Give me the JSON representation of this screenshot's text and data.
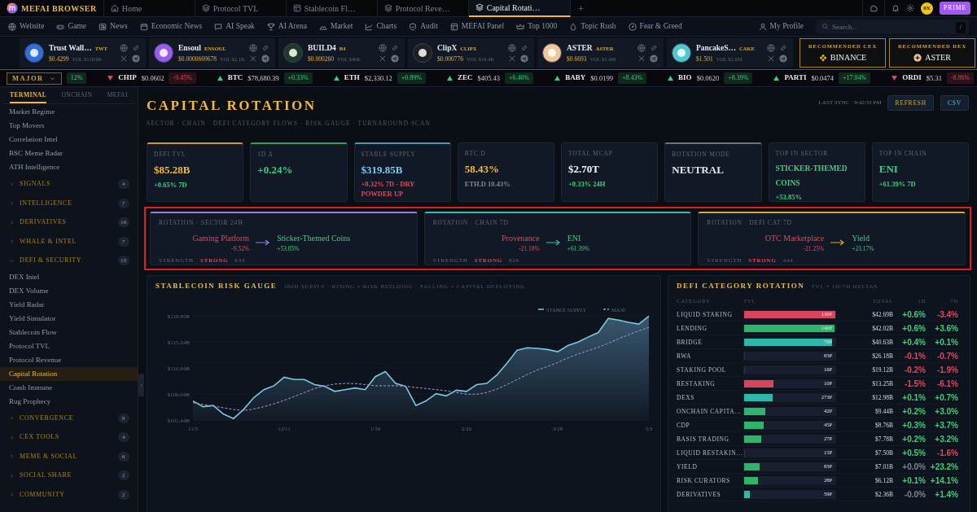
{
  "browser": {
    "brand": "MEFAI BROWSER",
    "tabs": [
      {
        "label": "Home",
        "selected": false
      },
      {
        "label": "Protocol TVL",
        "selected": false
      },
      {
        "label": "Stablecoin Fl…",
        "selected": false
      },
      {
        "label": "Protocol Reve…",
        "selected": false
      },
      {
        "label": "Capital Rotati…",
        "selected": true
      }
    ],
    "new_tab": "+",
    "avatar": "0X",
    "badge": "PRIME"
  },
  "nav": {
    "items": [
      "Website",
      "Game",
      "News",
      "Economic News",
      "AI Speak",
      "AI Arena",
      "Market",
      "Charts",
      "Audit",
      "MEFAI Panel",
      "Top 1000",
      "Topic Rush",
      "Fear & Greed"
    ],
    "profile": "My Profile",
    "search": {
      "placeholder": "Search...",
      "shortcut": "/"
    }
  },
  "tokens": [
    {
      "name": "Trust Wall…",
      "ticker": "TWT",
      "price": "$0.4299",
      "volume": "VOL $119.6K",
      "color": "#2f6fe0"
    },
    {
      "name": "Ensoul",
      "ticker": "ENSOUL",
      "price": "$0.0000669678",
      "volume": "VOL $2.1K",
      "color": "#9a5cf0"
    },
    {
      "name": "BUILD4",
      "ticker": "B4",
      "price": "$0.000260",
      "volume": "VOL $40K",
      "color": "#1f3a28"
    },
    {
      "name": "ClipX",
      "ticker": "CLIPX",
      "price": "$0.000776",
      "volume": "VOL $19.4K",
      "color": "#202020"
    },
    {
      "name": "ASTER",
      "ticker": "ASTER",
      "price": "$0.6693",
      "volume": "VOL $1.4M",
      "color": "#f2c79a"
    },
    {
      "name": "PancakeS…",
      "ticker": "CAKE",
      "price": "$1.501",
      "volume": "VOL $2.6M",
      "color": "#4fc8d0"
    }
  ],
  "recommended": [
    {
      "label": "RECOMMENDED CEX",
      "name": "BINANCE"
    },
    {
      "label": "RECOMMENDED DEX",
      "name": "ASTER"
    }
  ],
  "ticker": {
    "filter": "MAJOR",
    "items": [
      {
        "change": "12%",
        "rising": true
      },
      {
        "symbol": "CHIP",
        "price": "$0.0602",
        "change": "-9.45%",
        "rising": false
      },
      {
        "symbol": "BTC",
        "price": "$78,680.39",
        "change": "+0.33%",
        "rising": true
      },
      {
        "symbol": "ETH",
        "price": "$2,330.12",
        "change": "+0.89%",
        "rising": true
      },
      {
        "symbol": "ZEC",
        "price": "$405.43",
        "change": "+6.40%",
        "rising": true
      },
      {
        "symbol": "BABY",
        "price": "$0.0199",
        "change": "+8.43%",
        "rising": true
      },
      {
        "symbol": "BIO",
        "price": "$0.0620",
        "change": "+8.39%",
        "rising": true
      },
      {
        "symbol": "PARTI",
        "price": "$0.0474",
        "change": "+17.04%",
        "rising": true
      },
      {
        "symbol": "ORDI",
        "price": "$5.31",
        "change": "-8.86%",
        "rising": false
      }
    ]
  },
  "sidebar": {
    "tabs": [
      {
        "label": "TERMINAL",
        "selected": true
      },
      {
        "label": "ONCHAIN",
        "selected": false
      },
      {
        "label": "MEFAI",
        "selected": false
      }
    ],
    "items": [
      {
        "kind": "link",
        "label": "Market Regime",
        "selected": false
      },
      {
        "kind": "link",
        "label": "Top Movers",
        "selected": false
      },
      {
        "kind": "link",
        "label": "Correlation Intel",
        "selected": false
      },
      {
        "kind": "link",
        "label": "BSC Meme Radar",
        "selected": false
      },
      {
        "kind": "link",
        "label": "ATH Intelligence",
        "selected": false
      },
      {
        "kind": "group",
        "label": "SIGNALS",
        "count": "4",
        "expanded": false
      },
      {
        "kind": "group",
        "label": "INTELLIGENCE",
        "count": "7",
        "expanded": false
      },
      {
        "kind": "group",
        "label": "DERIVATIVES",
        "count": "16",
        "expanded": false
      },
      {
        "kind": "group",
        "label": "WHALE & INTEL",
        "count": "7",
        "expanded": false
      },
      {
        "kind": "group",
        "label": "DEFI & SECURITY",
        "count": "10",
        "expanded": true,
        "children": [
          {
            "kind": "link",
            "label": "DEX Intel",
            "selected": false
          },
          {
            "kind": "link",
            "label": "DEX Volume",
            "selected": false
          },
          {
            "kind": "link",
            "label": "Yield Radar",
            "selected": false
          },
          {
            "kind": "link",
            "label": "Yield Simulator",
            "selected": false
          },
          {
            "kind": "link",
            "label": "Stablecoin Flow",
            "selected": false
          },
          {
            "kind": "link",
            "label": "Protocol TVL",
            "selected": false
          },
          {
            "kind": "link",
            "label": "Protocol Revenue",
            "selected": false
          },
          {
            "kind": "link",
            "label": "Capital Rotation",
            "selected": true
          },
          {
            "kind": "link",
            "label": "Crash Immune",
            "selected": false
          },
          {
            "kind": "link",
            "label": "Rug Prophecy",
            "selected": false
          }
        ]
      },
      {
        "kind": "group",
        "label": "CONVERGENCE",
        "count": "8",
        "expanded": false
      },
      {
        "kind": "group",
        "label": "CEX TOOLS",
        "count": "4",
        "expanded": false
      },
      {
        "kind": "group",
        "label": "MEME & SOCIAL",
        "count": "6",
        "expanded": false
      },
      {
        "kind": "group",
        "label": "SOCIAL SHARE",
        "count": "2",
        "expanded": false
      },
      {
        "kind": "group",
        "label": "COMMUNITY",
        "count": "2",
        "expanded": false
      }
    ]
  },
  "page": {
    "title": "CAPITAL ROTATION",
    "subtitle": "SECTOR · CHAIN · DEFI CATEGORY FLOWS · RISK GAUGE · TURNAROUND SCAN",
    "last_sync": "LAST SYNC · 9:42:33 PM",
    "buttons": [
      "REFRESH",
      "CSV"
    ]
  },
  "metrics": [
    {
      "label": "DEFI TVL",
      "value": {
        "text": "$85.28B",
        "color": "#f0b93a"
      },
      "sub": {
        "text": "+0.65% 7D",
        "color": "#3ecf7a"
      },
      "color": "#c99a2e"
    },
    {
      "label": "1D Δ",
      "value": {
        "text": "+0.24%",
        "color": "#3ecf7a"
      },
      "color": "#2f9e63"
    },
    {
      "label": "STABLE SUPPLY",
      "value": {
        "text": "$319.85B",
        "color": "#7cc8f0"
      },
      "sub": {
        "text": "+0.32% 7D · DRY POWDER UP",
        "color": "#e8445a"
      },
      "color": "#5a8fb0"
    },
    {
      "label": "BTC.D",
      "value": {
        "text": "58.43%",
        "color": "#f0b93a"
      },
      "sub": {
        "text": "ETH.D 10.43%",
        "color": "#7d8594"
      }
    },
    {
      "label": "TOTAL MCAP",
      "value": {
        "text": "$2.70T",
        "color": "#eef1f5"
      },
      "sub": {
        "text": "+0.33% 24H",
        "color": "#3ecf7a"
      }
    },
    {
      "label": "ROTATION MODE",
      "value": {
        "text": "NEUTRAL",
        "color": "#e4e7ec"
      },
      "color": "#6b7280"
    },
    {
      "label": "TOP IN SECTOR",
      "value": {
        "text": "STICKER-THEMED COINS",
        "color": "#3ecf7a"
      },
      "sub": {
        "text": "+53.85%",
        "color": "#3ecf7a"
      }
    },
    {
      "label": "TOP IN CHAIN",
      "value": {
        "text": "ENI",
        "color": "#3ecf7a"
      },
      "sub": {
        "text": "+61.39% 7D",
        "color": "#3ecf7a"
      }
    }
  ],
  "rotations": [
    {
      "label": "ROTATION · SECTOR 24H",
      "from": "Gaming Platform",
      "from_change": "-9.52%",
      "to": "Sticker-Themed Coins",
      "to_change": "+53.85%",
      "strength_label": "STRENGTH",
      "strength": "STRONG",
      "score": "634",
      "color": "#9b7fe0"
    },
    {
      "label": "ROTATION · CHAIN 7D",
      "from": "Provenance",
      "from_change": "-21.18%",
      "to": "ENI",
      "to_change": "+61.39%",
      "strength_label": "STRENGTH",
      "strength": "STRONG",
      "score": "826",
      "color": "#2fc0a8"
    },
    {
      "label": "ROTATION · DEFI CAT 7D",
      "from": "OTC Marketplace",
      "from_change": "-21.25%",
      "to": "Yield",
      "to_change": "+23.17%",
      "strength_label": "STRENGTH",
      "strength": "STRONG",
      "score": "444",
      "color": "#d9a72a"
    }
  ],
  "risk_gauge": {
    "title": "STABLECOIN RISK GAUGE",
    "subtitle": "180D SUPPLY · RISING = RISK BUILDING · FALLING = CAPITAL DEPLOYING",
    "chart_data": {
      "type": "line",
      "legend": "upper right",
      "categories": [
        "11/5",
        null,
        null,
        null,
        null,
        null,
        null,
        null,
        null,
        "12/11",
        null,
        null,
        null,
        null,
        null,
        null,
        null,
        null,
        "1/16",
        null,
        null,
        null,
        null,
        null,
        null,
        null,
        null,
        "2/20",
        null,
        null,
        null,
        null,
        null,
        null,
        null,
        null,
        "3/28",
        null,
        null,
        null,
        null,
        null,
        null,
        null,
        null,
        "5/3"
      ],
      "series": [
        {
          "name": "STABLE SUPPLY",
          "color": "#7cc8e0",
          "type": "area",
          "line_style": "solid",
          "values": [
            104.8,
            103.8,
            104.0,
            102.5,
            101.7,
            103.3,
            105.4,
            106.8,
            107.5,
            109.0,
            108.6,
            108.6,
            107.7,
            107.4,
            106.5,
            106.8,
            107.1,
            106.8,
            109.1,
            110.0,
            107.9,
            107.4,
            104.0,
            104.8,
            106.1,
            105.7,
            106.7,
            106.5,
            107.7,
            107.9,
            109.4,
            111.5,
            113.8,
            114.2,
            114.1,
            113.9,
            113.5,
            114.6,
            115.2,
            116.1,
            116.9,
            119.4,
            119.1,
            118.7,
            118.4,
            119.8
          ]
        },
        {
          "name": "MA30",
          "color": "#a898d8",
          "type": "line",
          "line_style": "dashed",
          "values": [
            104.5,
            104.2,
            103.9,
            103.6,
            103.3,
            103.1,
            103.4,
            103.8,
            104.3,
            104.9,
            105.6,
            106.3,
            107.0,
            107.5,
            107.8,
            107.9,
            107.9,
            107.7,
            107.5,
            107.5,
            107.5,
            107.4,
            107.2,
            107.0,
            106.8,
            106.6,
            106.3,
            106.0,
            106.0,
            106.3,
            106.9,
            107.7,
            108.6,
            109.5,
            110.3,
            110.9,
            111.6,
            112.4,
            113.1,
            113.7,
            114.3,
            115.0,
            115.8,
            116.5,
            117.2,
            117.8
          ]
        }
      ],
      "ylim": [
        101.44,
        119.85
      ],
      "yticks": [
        {
          "value": 101.44,
          "label": "$101.44B"
        },
        {
          "value": 106.04,
          "label": "$106.04B"
        },
        {
          "value": 110.64,
          "label": "$110.64B"
        },
        {
          "value": 115.24,
          "label": "$115.24B"
        },
        {
          "value": 119.85,
          "label": "$119.85B"
        }
      ]
    }
  },
  "category_rotation": {
    "title": "DEFI CATEGORY ROTATION",
    "subtitle": "TVL + 1D/7D DELTAS",
    "columns": [
      "CATEGORY",
      "TVL",
      "TOTAL",
      "1D",
      "7D"
    ],
    "rows": [
      {
        "category": "LIQUID STAKING",
        "level": 1.0,
        "color": "#d8455c",
        "bar_label": "130P",
        "total": "$42.69B",
        "d1": {
          "text": "+0.6%",
          "color": "#3ecf7a"
        },
        "d7": {
          "text": "-3.4%",
          "color": "#e8445a"
        }
      },
      {
        "category": "LENDING",
        "level": 0.99,
        "color": "#2fb56a",
        "bar_label": "140P",
        "total": "$42.02B",
        "d1": {
          "text": "+0.6%",
          "color": "#3ecf7a"
        },
        "d7": {
          "text": "+3.6%",
          "color": "#3ecf7a"
        }
      },
      {
        "category": "BRIDGE",
        "level": 0.96,
        "color": "#2fb8a8",
        "bar_label": "78P",
        "total": "$40.63B",
        "d1": {
          "text": "+0.4%",
          "color": "#3ecf7a"
        },
        "d7": {
          "text": "+0.1%",
          "color": "#3ecf7a"
        }
      },
      {
        "category": "RWA",
        "level": 0,
        "bar_label": "83P",
        "total": "$26.18B",
        "d1": {
          "text": "-0.1%",
          "color": "#e8445a"
        },
        "d7": {
          "text": "-0.7%",
          "color": "#e8445a"
        }
      },
      {
        "category": "STAKING POOL",
        "level": 0,
        "bar_label": "16P",
        "total": "$19.12B",
        "d1": {
          "text": "-0.2%",
          "color": "#e8445a"
        },
        "d7": {
          "text": "-1.9%",
          "color": "#e8445a"
        }
      },
      {
        "category": "RESTAKING",
        "level": 0.32,
        "color": "#d8455c",
        "bar_label": "10P",
        "total": "$13.25B",
        "d1": {
          "text": "-1.5%",
          "color": "#e8445a"
        },
        "d7": {
          "text": "-6.1%",
          "color": "#e8445a"
        }
      },
      {
        "category": "DEXS",
        "level": 0.31,
        "color": "#2fb8a8",
        "bar_label": "273P",
        "total": "$12.98B",
        "d1": {
          "text": "+0.1%",
          "color": "#3ecf7a"
        },
        "d7": {
          "text": "+0.7%",
          "color": "#3ecf7a"
        }
      },
      {
        "category": "ONCHAIN CAPITA…",
        "level": 0.23,
        "color": "#2fb56a",
        "bar_label": "42P",
        "total": "$9.44B",
        "d1": {
          "text": "+0.2%",
          "color": "#3ecf7a"
        },
        "d7": {
          "text": "+3.0%",
          "color": "#3ecf7a"
        }
      },
      {
        "category": "CDP",
        "level": 0.21,
        "color": "#2fb56a",
        "bar_label": "45P",
        "total": "$8.76B",
        "d1": {
          "text": "+0.3%",
          "color": "#3ecf7a"
        },
        "d7": {
          "text": "+3.7%",
          "color": "#3ecf7a"
        }
      },
      {
        "category": "BASIS TRADING",
        "level": 0.19,
        "color": "#2fb56a",
        "bar_label": "27P",
        "total": "$7.78B",
        "d1": {
          "text": "+0.2%",
          "color": "#3ecf7a"
        },
        "d7": {
          "text": "+3.2%",
          "color": "#3ecf7a"
        }
      },
      {
        "category": "LIQUID RESTAKIN…",
        "level": 0,
        "bar_label": "15P",
        "total": "$7.50B",
        "d1": {
          "text": "+0.5%",
          "color": "#3ecf7a"
        },
        "d7": {
          "text": "-1.6%",
          "color": "#e8445a"
        }
      },
      {
        "category": "YIELD",
        "level": 0.17,
        "color": "#2fb56a",
        "bar_label": "83P",
        "total": "$7.01B",
        "d1": {
          "text": "+0.0%",
          "color": "#7d8594"
        },
        "d7": {
          "text": "+23.2%",
          "color": "#3ecf7a"
        }
      },
      {
        "category": "RISK CURATORS",
        "level": 0.15,
        "color": "#2fb56a",
        "bar_label": "28P",
        "total": "$6.12B",
        "d1": {
          "text": "+0.1%",
          "color": "#3ecf7a"
        },
        "d7": {
          "text": "+14.1%",
          "color": "#3ecf7a"
        }
      },
      {
        "category": "DERIVATIVES",
        "level": 0.06,
        "color": "#2fb8a8",
        "bar_label": "59P",
        "total": "$2.36B",
        "d1": {
          "text": "-0.0%",
          "color": "#7d8594"
        },
        "d7": {
          "text": "+1.4%",
          "color": "#3ecf7a"
        }
      }
    ]
  }
}
